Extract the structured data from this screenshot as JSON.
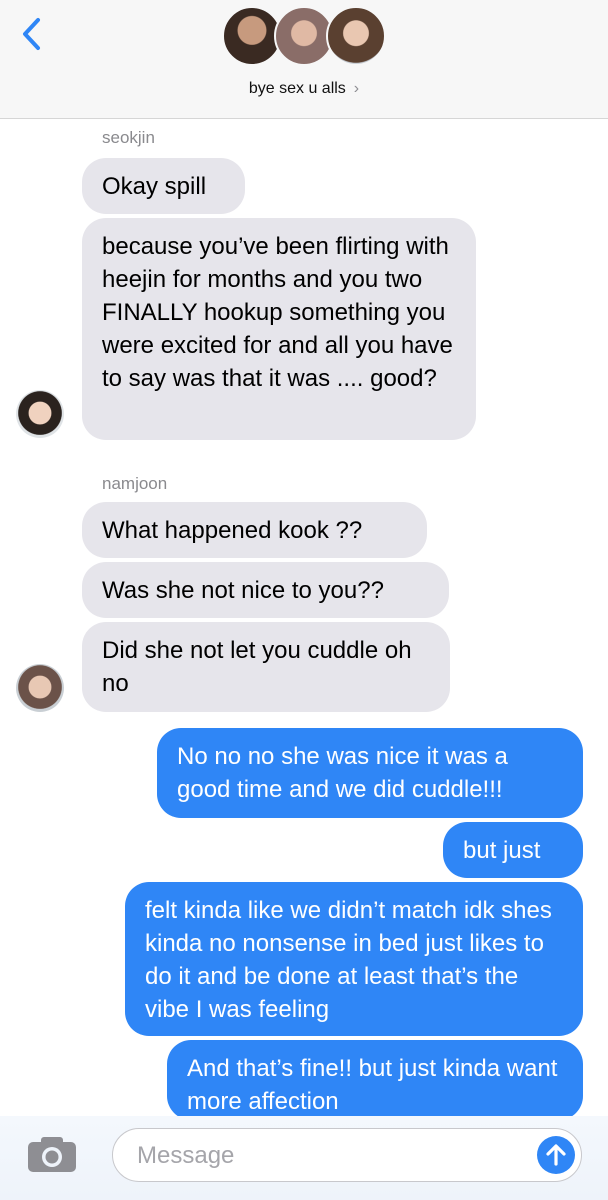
{
  "header": {
    "title": "bye sex u alls",
    "chevron": "›",
    "back_icon": "chevron-left-icon",
    "accent": "#2f86f6"
  },
  "thread": {
    "groups": [
      {
        "sender": "seokjin",
        "messages": [
          "Okay spill",
          "because you’ve been flirting with heejin for months and you two FINALLY hookup something you were excited for and all you have to say was that it was .... good?"
        ]
      },
      {
        "sender": "namjoon",
        "messages": [
          "What happened kook ??",
          "Was she not nice to you??",
          "Did she not let you cuddle oh no"
        ]
      }
    ],
    "outgoing": [
      "No no no she was nice it was a good time and we did cuddle!!!",
      "but just",
      "felt kinda like we didn’t match idk shes kinda no nonsense in bed just likes to do it and be done at least that’s the vibe I was feeling",
      "And that’s fine!! but just kinda want more affection"
    ]
  },
  "composer": {
    "placeholder": "Message",
    "camera_icon": "camera-icon",
    "send_icon": "arrow-up-icon"
  },
  "colors": {
    "incoming_bubble": "#e6e5eb",
    "outgoing_bubble": "#2f86f6"
  }
}
